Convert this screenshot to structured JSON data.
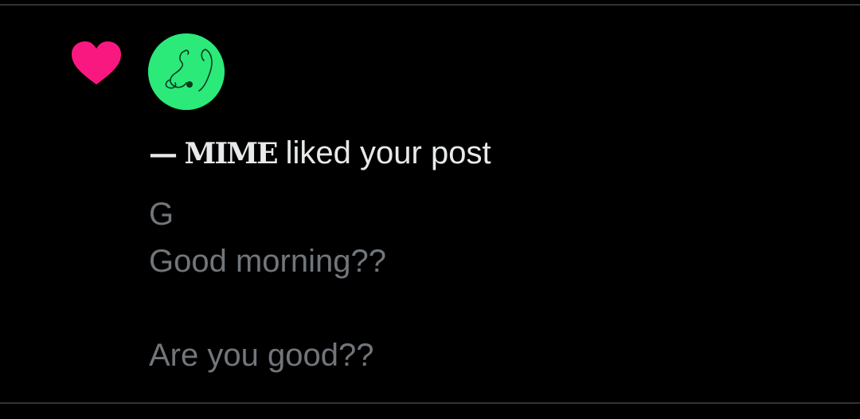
{
  "notification": {
    "icon": "heart-icon",
    "icon_color": "#f91880",
    "avatar_color": "#2bea7a",
    "user_name": "— MIME",
    "action_text": "liked your post",
    "post_lines": [
      "G",
      "Good morning??",
      "",
      "Are you good??"
    ]
  },
  "colors": {
    "background": "#000000",
    "primary_text": "#e7e9ea",
    "secondary_text": "#71767b",
    "divider": "#2f3336"
  }
}
